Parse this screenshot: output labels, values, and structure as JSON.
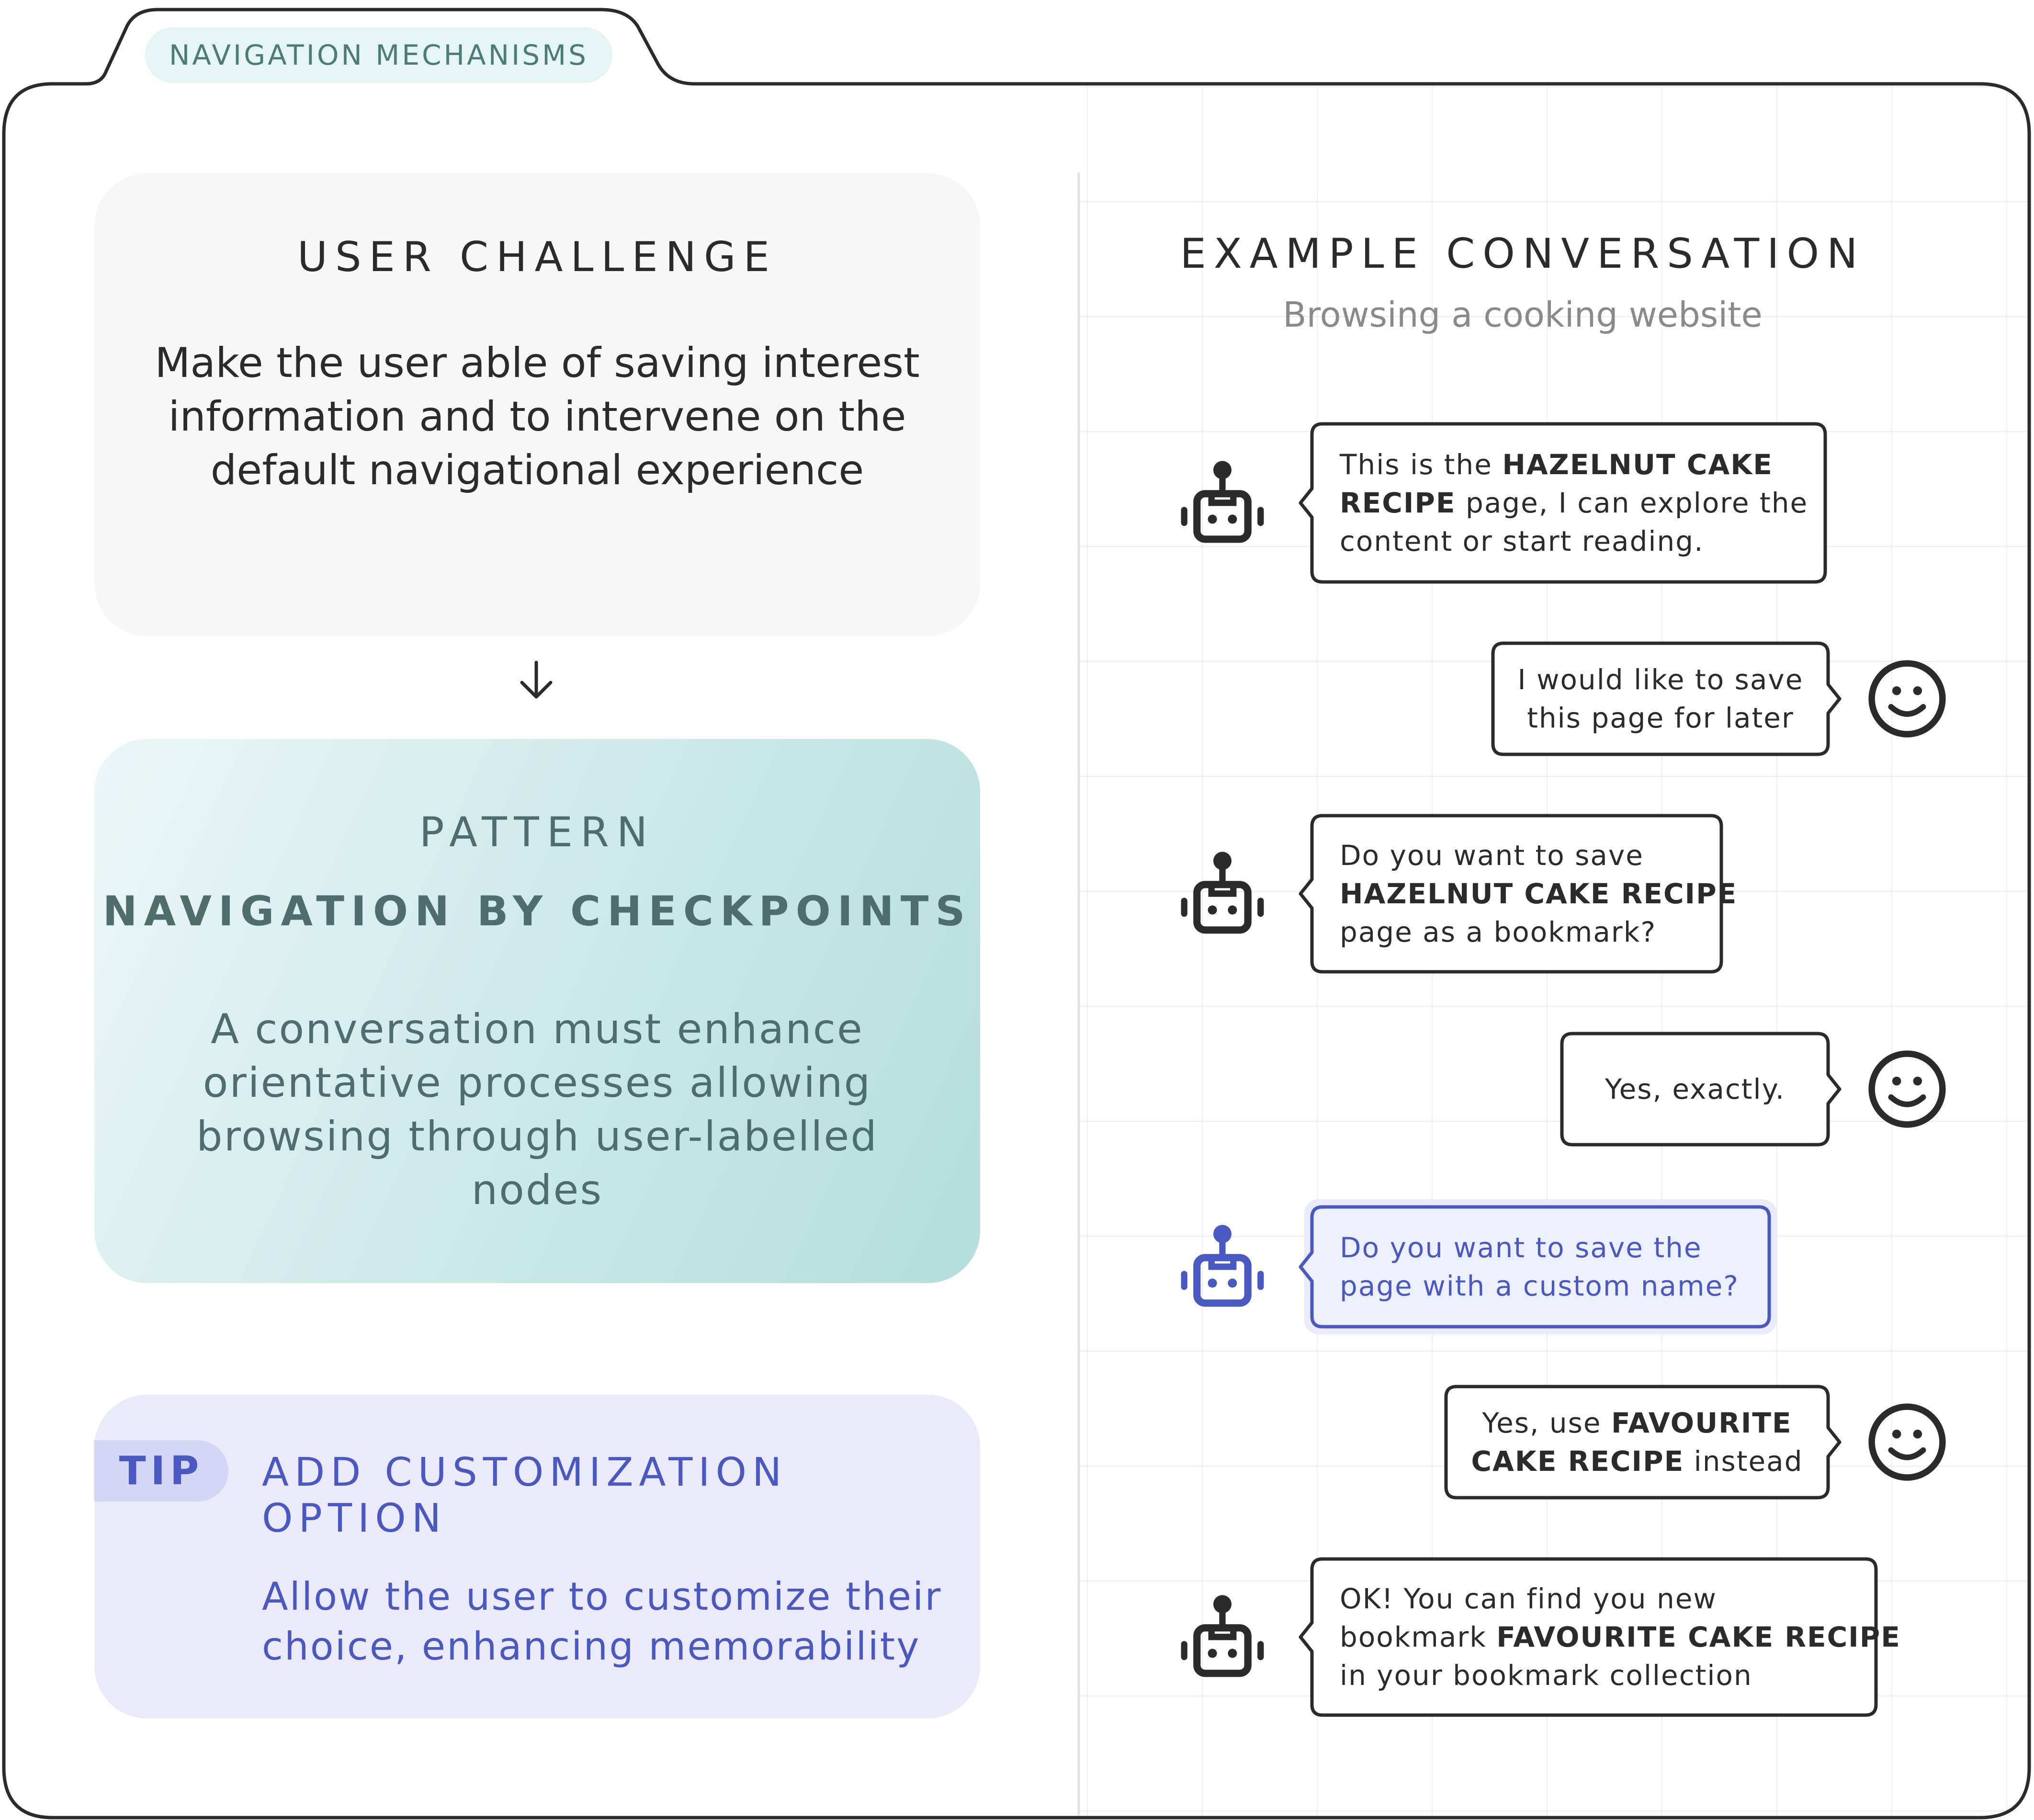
{
  "header": {
    "tab_label": "NAVIGATION MECHANISMS"
  },
  "challenge": {
    "title": "USER CHALLENGE",
    "body": "Make the user able of saving interest information and to intervene on the default navigational experience"
  },
  "pattern": {
    "kicker": "PATTERN",
    "name": "NAVIGATION BY CHECKPOINTS",
    "body": "A conversation must enhance orientative processes allowing browsing through user-labelled nodes"
  },
  "tip": {
    "badge": "TIP",
    "title": "ADD CUSTOMIZATION OPTION",
    "body": "Allow the user to customize their choice, enhancing memorability"
  },
  "conversation": {
    "title": "EXAMPLE CONVERSATION",
    "subtitle": "Browsing a cooking website",
    "messages": [
      {
        "speaker": "bot",
        "highlight": false,
        "lines": [
          [
            {
              "t": "This is the ",
              "b": false
            },
            {
              "t": "HAZELNUT CAKE",
              "b": true
            }
          ],
          [
            {
              "t": "RECIPE",
              "b": true
            },
            {
              "t": " page, I can explore the",
              "b": false
            }
          ],
          [
            {
              "t": "content or start reading.",
              "b": false
            }
          ]
        ]
      },
      {
        "speaker": "user",
        "highlight": false,
        "lines": [
          [
            {
              "t": "I would like to save",
              "b": false
            }
          ],
          [
            {
              "t": "this page for later",
              "b": false
            }
          ]
        ]
      },
      {
        "speaker": "bot",
        "highlight": false,
        "lines": [
          [
            {
              "t": "Do you want to save",
              "b": false
            }
          ],
          [
            {
              "t": "HAZELNUT CAKE RECIPE",
              "b": true
            }
          ],
          [
            {
              "t": "page as a bookmark?",
              "b": false
            }
          ]
        ]
      },
      {
        "speaker": "user",
        "highlight": false,
        "lines": [
          [
            {
              "t": "Yes, exactly.",
              "b": false
            }
          ]
        ]
      },
      {
        "speaker": "bot",
        "highlight": true,
        "lines": [
          [
            {
              "t": "Do you want to save the",
              "b": false
            }
          ],
          [
            {
              "t": "page with a custom name?",
              "b": false
            }
          ]
        ]
      },
      {
        "speaker": "user",
        "highlight": false,
        "lines": [
          [
            {
              "t": "Yes, use ",
              "b": false
            },
            {
              "t": "FAVOURITE",
              "b": true
            }
          ],
          [
            {
              "t": "CAKE RECIPE",
              "b": true
            },
            {
              "t": " instead",
              "b": false
            }
          ]
        ]
      },
      {
        "speaker": "bot",
        "highlight": false,
        "lines": [
          [
            {
              "t": "OK! You can find you new",
              "b": false
            }
          ],
          [
            {
              "t": "bookmark ",
              "b": false
            },
            {
              "t": "FAVOURITE CAKE RECIPE",
              "b": true
            }
          ],
          [
            {
              "t": "in your bookmark collection",
              "b": false
            }
          ]
        ]
      }
    ]
  },
  "colors": {
    "outline": "#2b2b2b",
    "teal_text": "#4f6d6b",
    "tip_blue": "#4a58c2",
    "tip_bg": "#eaeafb",
    "highlight_bubble_bg": "#eceffc",
    "grid": "#ececec"
  },
  "icons": {
    "bot": "robot-icon",
    "user": "smiley-icon",
    "arrow": "arrow-down-icon"
  }
}
